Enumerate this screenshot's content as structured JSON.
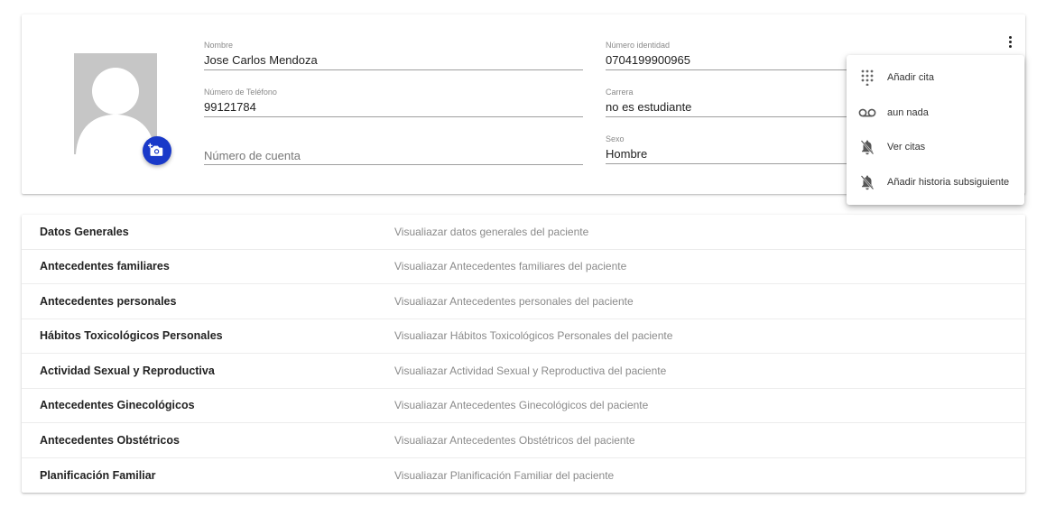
{
  "patient": {
    "nombre_label": "Nombre",
    "nombre_value": "Jose Carlos Mendoza",
    "identidad_label": "Número identidad",
    "identidad_value": "0704199900965",
    "telefono_label": "Número de Teléfono",
    "telefono_value": "99121784",
    "carrera_label": "Carrera",
    "carrera_value": "no es estudiante",
    "cuenta_placeholder": "Número de cuenta",
    "cuenta_value": "",
    "sexo_label": "Sexo",
    "sexo_value": "Hombre"
  },
  "icons": {
    "avatar": "person-placeholder-icon",
    "camera": "add-photo-icon",
    "more": "more-vert-icon"
  },
  "menu": {
    "items": [
      {
        "label": "Añadir cita",
        "icon": "dialpad-icon"
      },
      {
        "label": "aun nada",
        "icon": "voicemail-icon"
      },
      {
        "label": "Ver citas",
        "icon": "notifications-off-icon"
      },
      {
        "label": "Añadir historia subsiguiente",
        "icon": "notifications-off-icon"
      }
    ]
  },
  "sections": [
    {
      "title": "Datos Generales",
      "description": "Visualiazar datos generales del paciente"
    },
    {
      "title": "Antecedentes familiares",
      "description": "Visualiazar Antecedentes familiares del paciente"
    },
    {
      "title": "Antecedentes personales",
      "description": "Visualiazar Antecedentes personales del paciente"
    },
    {
      "title": "Hábitos Toxicológicos Personales",
      "description": "Visualiazar Hábitos Toxicológicos Personales del paciente"
    },
    {
      "title": "Actividad Sexual y Reproductiva",
      "description": "Visualiazar Actividad Sexual y Reproductiva del paciente"
    },
    {
      "title": "Antecedentes Ginecológicos",
      "description": "Visualiazar Antecedentes Ginecológicos del paciente"
    },
    {
      "title": "Antecedentes Obstétricos",
      "description": "Visualiazar Antecedentes Obstétricos del paciente"
    },
    {
      "title": "Planificación Familiar",
      "description": "Visualiazar Planificación Familiar del paciente"
    }
  ],
  "colors": {
    "accent": "#1939c9",
    "avatar_bg": "#c6c6c6",
    "muted_text": "#8a8a8a"
  }
}
